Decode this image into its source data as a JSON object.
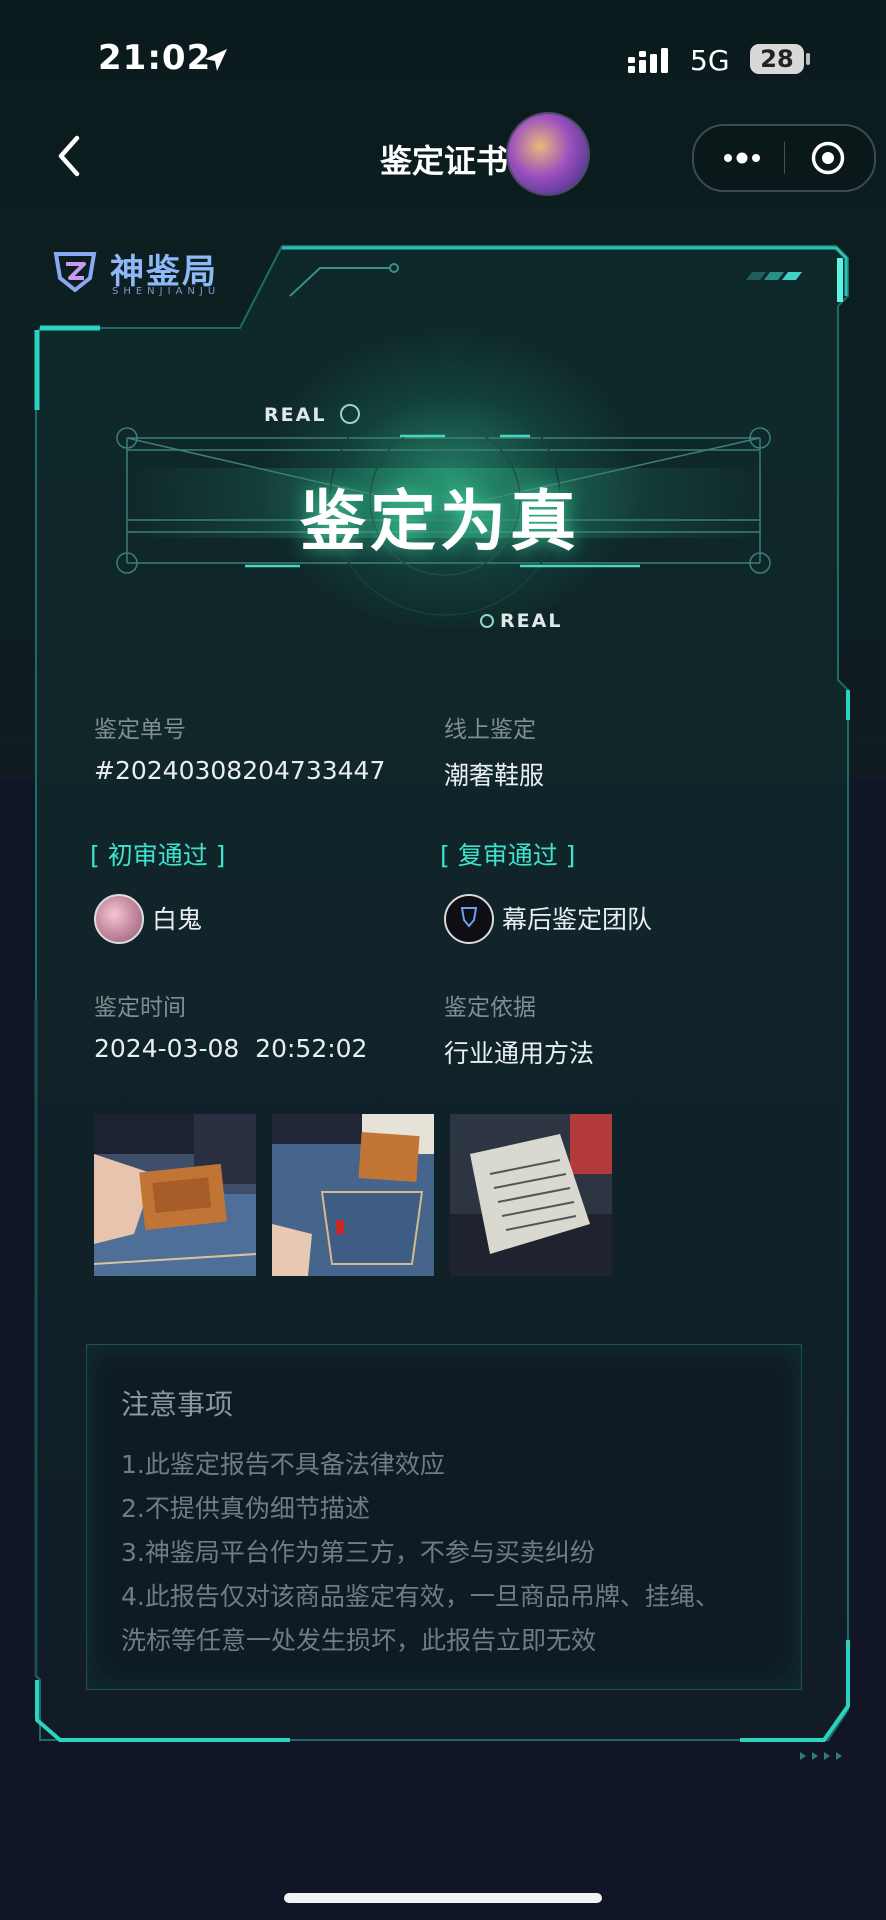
{
  "status_bar": {
    "time": "21:02",
    "network": "5G",
    "battery": "28"
  },
  "nav": {
    "title": "鉴定证书"
  },
  "logo": {
    "name": "神鉴局",
    "sub": "SHENJIANJU"
  },
  "hero": {
    "verdict": "鉴定为真",
    "tag_top": "REAL",
    "tag_bottom": "REAL"
  },
  "info": {
    "order_label": "鉴定单号",
    "order_value": "#20240308204733447",
    "mode_label": "线上鉴定",
    "mode_value": "潮奢鞋服",
    "first_review_tag": "[ 初审通过 ]",
    "first_reviewer": "白鬼",
    "second_review_tag": "[ 复审通过 ]",
    "second_reviewer": "幕后鉴定团队",
    "time_label": "鉴定时间",
    "time_value": "2024-03-08  20:52:02",
    "basis_label": "鉴定依据",
    "basis_value": "行业通用方法"
  },
  "notice": {
    "title": "注意事项",
    "items": [
      "1.此鉴定报告不具备法律效应",
      "2.不提供真伪细节描述",
      "3.神鉴局平台作为第三方，不参与买卖纠纷",
      "4.此报告仅对该商品鉴定有效，一旦商品吊牌、挂绳、",
      "洗标等任意一处发生损坏，此报告立即无效"
    ]
  },
  "colors": {
    "accent": "#3fe1cf",
    "frame": "#2ad3c2",
    "background": "#111626"
  }
}
